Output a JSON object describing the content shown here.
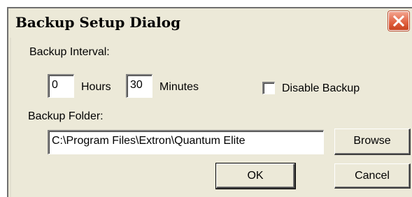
{
  "window": {
    "title": "Backup Setup Dialog",
    "close_icon": "close-icon"
  },
  "interval": {
    "label": "Backup Interval:",
    "hours_value": "0",
    "hours_label": "Hours",
    "minutes_value": "30",
    "minutes_label": "Minutes",
    "disable_label": "Disable Backup",
    "disable_checked": false
  },
  "folder": {
    "label": "Backup Folder:",
    "path": "C:\\Program Files\\Extron\\Quantum Elite"
  },
  "buttons": {
    "browse": "Browse",
    "ok": "OK",
    "cancel": "Cancel"
  },
  "colors": {
    "dialog_bg": "#ece9d8",
    "close_red": "#e0603f"
  }
}
